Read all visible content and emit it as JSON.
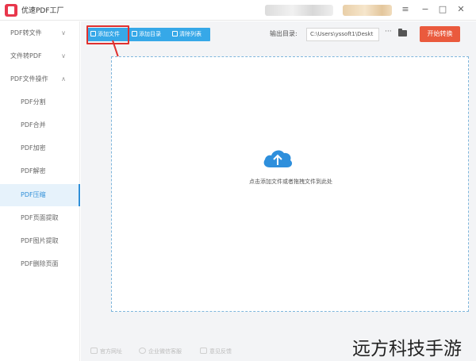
{
  "window": {
    "title": "优速PDF工厂",
    "controls": {
      "menu": "≡",
      "minimize": "−",
      "maximize": "□",
      "close": "✕"
    }
  },
  "sidebar": {
    "items": [
      {
        "label": "PDF转文件",
        "chevron": "∨"
      },
      {
        "label": "文件转PDF",
        "chevron": "∨"
      },
      {
        "label": "PDF文件操作",
        "chevron": "∧"
      },
      {
        "label": "PDF分割"
      },
      {
        "label": "PDF合并"
      },
      {
        "label": "PDF加密"
      },
      {
        "label": "PDF解密"
      },
      {
        "label": "PDF压缩",
        "active": true
      },
      {
        "label": "PDF页面提取"
      },
      {
        "label": "PDF图片提取"
      },
      {
        "label": "PDF删除页面"
      }
    ]
  },
  "toolbar": {
    "add_file": "添加文件",
    "add_folder": "添加目录",
    "clear_list": "清除列表",
    "output_label": "输出目录:",
    "output_path": "C:\\Users\\yssoft1\\Deskt",
    "more": "···",
    "start": "开始转换"
  },
  "dropzone": {
    "text": "点击添加文件或者拖拽文件到此处"
  },
  "footer": {
    "website": "官方网址",
    "support": "企业微信客服",
    "feedback": "意见反馈"
  },
  "watermark": "远方科技手游",
  "colors": {
    "accent": "#36a8e8",
    "start_button": "#ea5a3d",
    "annotation": "#e0312f",
    "active_item": "#2f8fd8"
  }
}
